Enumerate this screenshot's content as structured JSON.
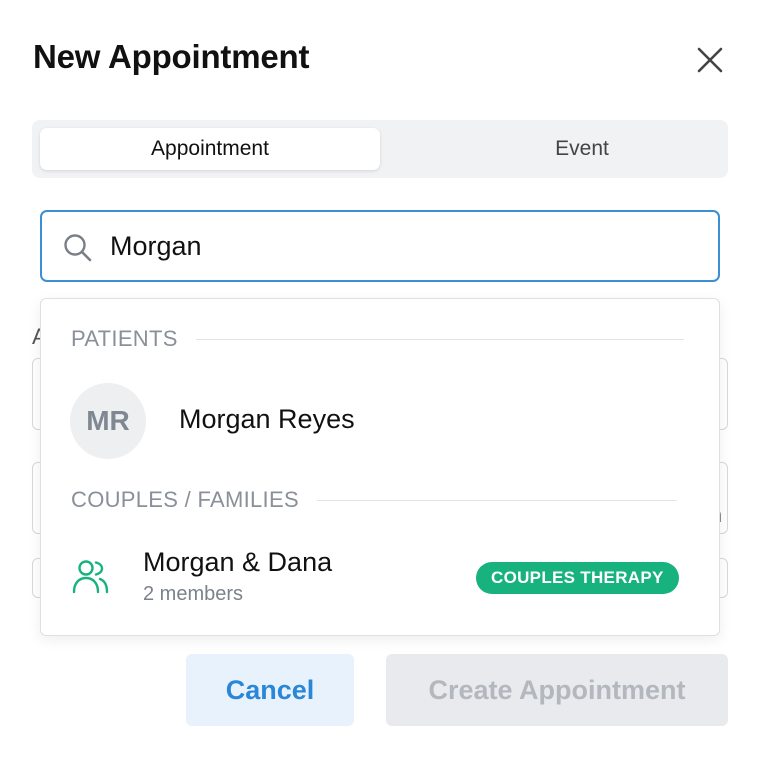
{
  "dialog": {
    "title": "New Appointment"
  },
  "tabs": [
    {
      "label": "Appointment",
      "active": true
    },
    {
      "label": "Event",
      "active": false
    }
  ],
  "search": {
    "value": "Morgan",
    "icon": "search-icon"
  },
  "background_form": {
    "label_fragment": "A",
    "text_fragment": "n"
  },
  "dropdown": {
    "patients_heading": "PATIENTS",
    "patients": [
      {
        "initials": "MR",
        "name": "Morgan Reyes"
      }
    ],
    "couples_heading": "COUPLES / FAMILIES",
    "couples": [
      {
        "name": "Morgan & Dana",
        "meta": "2 members",
        "badge": "COUPLES THERAPY",
        "icon": "group-icon"
      }
    ]
  },
  "footer": {
    "cancel_label": "Cancel",
    "create_label": "Create Appointment"
  },
  "colors": {
    "accent": "#3b8fd4",
    "badge": "#18b27e",
    "cancel_text": "#2a86d6",
    "disabled_text": "#b3b8bf"
  }
}
